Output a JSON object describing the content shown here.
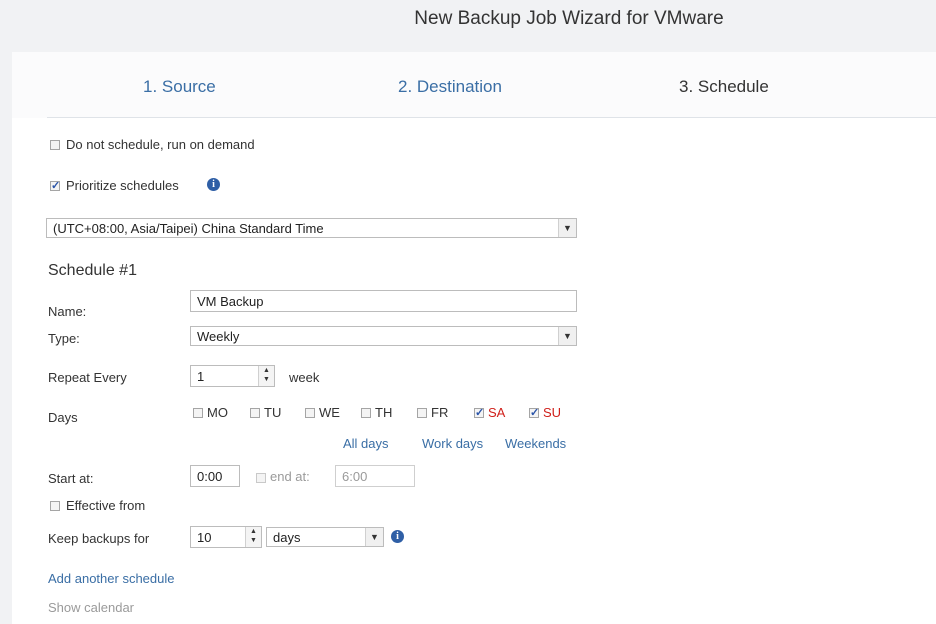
{
  "header": {
    "title": "New Backup Job Wizard for VMware"
  },
  "steps": [
    {
      "label": "1. Source"
    },
    {
      "label": "2. Destination"
    },
    {
      "label": "3. Schedule"
    }
  ],
  "options": {
    "no_schedule_label": "Do not schedule, run on demand",
    "no_schedule_checked": false,
    "prioritize_label": "Prioritize schedules",
    "prioritize_checked": true
  },
  "timezone": {
    "value": "(UTC+08:00, Asia/Taipei) China Standard Time"
  },
  "schedule": {
    "heading": "Schedule #1",
    "name_label": "Name:",
    "name_value": "VM Backup",
    "type_label": "Type:",
    "type_value": "Weekly",
    "repeat_label": "Repeat Every",
    "repeat_value": "1",
    "repeat_unit": "week",
    "days_label": "Days",
    "days": [
      {
        "label": "MO",
        "checked": false
      },
      {
        "label": "TU",
        "checked": false
      },
      {
        "label": "WE",
        "checked": false
      },
      {
        "label": "TH",
        "checked": false
      },
      {
        "label": "FR",
        "checked": false
      },
      {
        "label": "SA",
        "checked": true
      },
      {
        "label": "SU",
        "checked": true
      }
    ],
    "quick_links": {
      "all": "All days",
      "work": "Work days",
      "weekends": "Weekends"
    },
    "start_label": "Start at:",
    "start_value": "0:00",
    "end_label": "end at:",
    "end_value": "6:00",
    "end_checked": false,
    "effective_label": "Effective from",
    "effective_checked": false,
    "keep_label": "Keep backups for",
    "keep_value": "10",
    "keep_unit": "days"
  },
  "links": {
    "add_schedule": "Add another schedule",
    "show_calendar": "Show calendar"
  },
  "colors": {
    "link": "#3a6ea5",
    "weekend": "#d0201b",
    "header_bg": "#f1f2f4"
  }
}
